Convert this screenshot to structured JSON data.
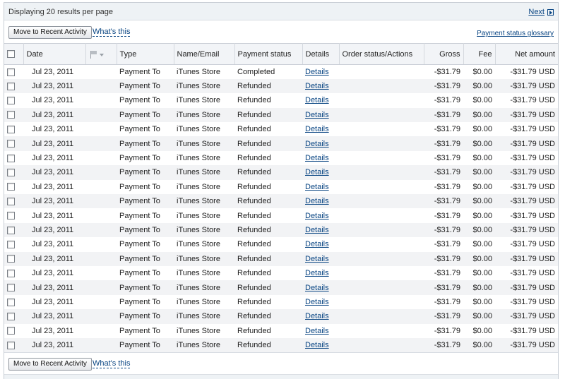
{
  "header": {
    "displaying": "Displaying 20 results per page",
    "next_label": "Next"
  },
  "toolbar": {
    "move_button": "Move to Recent Activity",
    "whats_this": "What's this",
    "glossary": "Payment status glossary"
  },
  "columns": {
    "date": "Date",
    "type": "Type",
    "name": "Name/Email",
    "status": "Payment status",
    "details": "Details",
    "order": "Order status/Actions",
    "gross": "Gross",
    "fee": "Fee",
    "net": "Net amount"
  },
  "rows": [
    {
      "date": "Jul 23, 2011",
      "type": "Payment To",
      "name": "iTunes Store",
      "status": "Completed",
      "details": "Details",
      "gross": "-$31.79",
      "fee": "$0.00",
      "net": "-$31.79 USD"
    },
    {
      "date": "Jul 23, 2011",
      "type": "Payment To",
      "name": "iTunes Store",
      "status": "Refunded",
      "details": "Details",
      "gross": "-$31.79",
      "fee": "$0.00",
      "net": "-$31.79 USD"
    },
    {
      "date": "Jul 23, 2011",
      "type": "Payment To",
      "name": "iTunes Store",
      "status": "Refunded",
      "details": "Details",
      "gross": "-$31.79",
      "fee": "$0.00",
      "net": "-$31.79 USD"
    },
    {
      "date": "Jul 23, 2011",
      "type": "Payment To",
      "name": "iTunes Store",
      "status": "Refunded",
      "details": "Details",
      "gross": "-$31.79",
      "fee": "$0.00",
      "net": "-$31.79 USD"
    },
    {
      "date": "Jul 23, 2011",
      "type": "Payment To",
      "name": "iTunes Store",
      "status": "Refunded",
      "details": "Details",
      "gross": "-$31.79",
      "fee": "$0.00",
      "net": "-$31.79 USD"
    },
    {
      "date": "Jul 23, 2011",
      "type": "Payment To",
      "name": "iTunes Store",
      "status": "Refunded",
      "details": "Details",
      "gross": "-$31.79",
      "fee": "$0.00",
      "net": "-$31.79 USD"
    },
    {
      "date": "Jul 23, 2011",
      "type": "Payment To",
      "name": "iTunes Store",
      "status": "Refunded",
      "details": "Details",
      "gross": "-$31.79",
      "fee": "$0.00",
      "net": "-$31.79 USD"
    },
    {
      "date": "Jul 23, 2011",
      "type": "Payment To",
      "name": "iTunes Store",
      "status": "Refunded",
      "details": "Details",
      "gross": "-$31.79",
      "fee": "$0.00",
      "net": "-$31.79 USD"
    },
    {
      "date": "Jul 23, 2011",
      "type": "Payment To",
      "name": "iTunes Store",
      "status": "Refunded",
      "details": "Details",
      "gross": "-$31.79",
      "fee": "$0.00",
      "net": "-$31.79 USD"
    },
    {
      "date": "Jul 23, 2011",
      "type": "Payment To",
      "name": "iTunes Store",
      "status": "Refunded",
      "details": "Details",
      "gross": "-$31.79",
      "fee": "$0.00",
      "net": "-$31.79 USD"
    },
    {
      "date": "Jul 23, 2011",
      "type": "Payment To",
      "name": "iTunes Store",
      "status": "Refunded",
      "details": "Details",
      "gross": "-$31.79",
      "fee": "$0.00",
      "net": "-$31.79 USD"
    },
    {
      "date": "Jul 23, 2011",
      "type": "Payment To",
      "name": "iTunes Store",
      "status": "Refunded",
      "details": "Details",
      "gross": "-$31.79",
      "fee": "$0.00",
      "net": "-$31.79 USD"
    },
    {
      "date": "Jul 23, 2011",
      "type": "Payment To",
      "name": "iTunes Store",
      "status": "Refunded",
      "details": "Details",
      "gross": "-$31.79",
      "fee": "$0.00",
      "net": "-$31.79 USD"
    },
    {
      "date": "Jul 23, 2011",
      "type": "Payment To",
      "name": "iTunes Store",
      "status": "Refunded",
      "details": "Details",
      "gross": "-$31.79",
      "fee": "$0.00",
      "net": "-$31.79 USD"
    },
    {
      "date": "Jul 23, 2011",
      "type": "Payment To",
      "name": "iTunes Store",
      "status": "Refunded",
      "details": "Details",
      "gross": "-$31.79",
      "fee": "$0.00",
      "net": "-$31.79 USD"
    },
    {
      "date": "Jul 23, 2011",
      "type": "Payment To",
      "name": "iTunes Store",
      "status": "Refunded",
      "details": "Details",
      "gross": "-$31.79",
      "fee": "$0.00",
      "net": "-$31.79 USD"
    },
    {
      "date": "Jul 23, 2011",
      "type": "Payment To",
      "name": "iTunes Store",
      "status": "Refunded",
      "details": "Details",
      "gross": "-$31.79",
      "fee": "$0.00",
      "net": "-$31.79 USD"
    },
    {
      "date": "Jul 23, 2011",
      "type": "Payment To",
      "name": "iTunes Store",
      "status": "Refunded",
      "details": "Details",
      "gross": "-$31.79",
      "fee": "$0.00",
      "net": "-$31.79 USD"
    },
    {
      "date": "Jul 23, 2011",
      "type": "Payment To",
      "name": "iTunes Store",
      "status": "Refunded",
      "details": "Details",
      "gross": "-$31.79",
      "fee": "$0.00",
      "net": "-$31.79 USD"
    },
    {
      "date": "Jul 23, 2011",
      "type": "Payment To",
      "name": "iTunes Store",
      "status": "Refunded",
      "details": "Details",
      "gross": "-$31.79",
      "fee": "$0.00",
      "net": "-$31.79 USD"
    }
  ],
  "icons": {
    "next": "next-arrow-icon",
    "flag": "flag-icon",
    "sort": "chevron-down-icon"
  },
  "colors": {
    "link": "#084482",
    "header_bg": "#f2f4f7",
    "stripe": "#f2f3f5"
  }
}
